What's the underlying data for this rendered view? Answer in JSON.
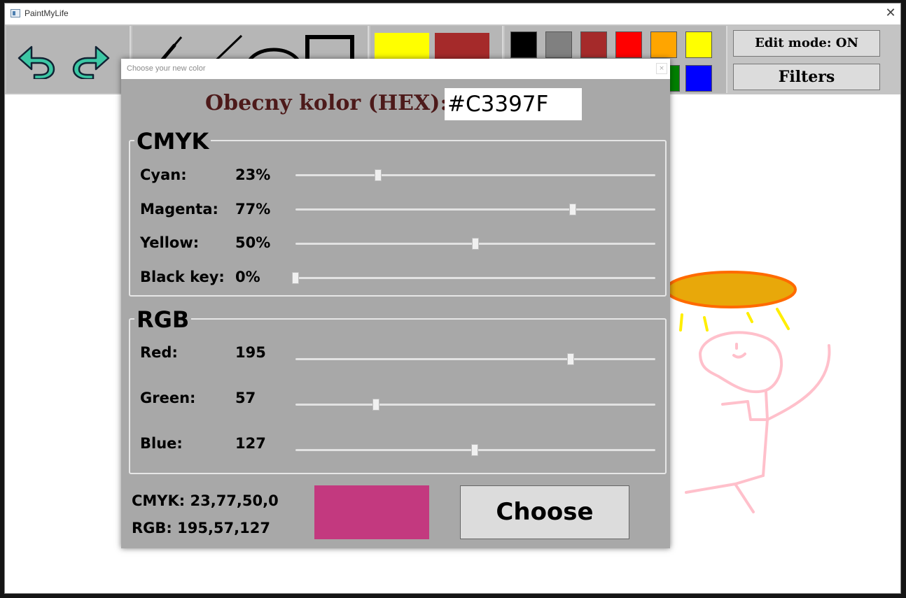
{
  "app": {
    "title": "PaintMyLife",
    "close_glyph": "✕"
  },
  "toolbar": {
    "undo_icon": "undo-arrow",
    "redo_icon": "redo-arrow",
    "primary_color": "#FFFF00",
    "secondary_color": "#A52A2A",
    "palette": [
      {
        "name": "black",
        "hex": "#000000"
      },
      {
        "name": "gray",
        "hex": "#808080"
      },
      {
        "name": "brown",
        "hex": "#A52A2A"
      },
      {
        "name": "red",
        "hex": "#FF0000"
      },
      {
        "name": "orange",
        "hex": "#FFA500"
      },
      {
        "name": "yellow",
        "hex": "#FFFF00"
      },
      {
        "name": "green",
        "hex": "#008000"
      },
      {
        "name": "blue",
        "hex": "#0000FF"
      }
    ],
    "edit_mode_label": "Edit mode: ON",
    "filters_label": "Filters"
  },
  "dialog": {
    "title": "Choose your new color",
    "close_glyph": "×",
    "hex_label": "Obecny kolor (HEX):",
    "hex_value": "#C3397F",
    "cmyk": {
      "title": "CMYK",
      "rows": [
        {
          "label": "Cyan:",
          "value": "23%",
          "level": 0.23
        },
        {
          "label": "Magenta:",
          "value": "77%",
          "level": 0.77
        },
        {
          "label": "Yellow:",
          "value": "50%",
          "level": 0.5
        },
        {
          "label": "Black key:",
          "value": "0%",
          "level": 0.0
        }
      ]
    },
    "rgb": {
      "title": "RGB",
      "rows": [
        {
          "label": "Red:",
          "value": "195",
          "level": 0.765
        },
        {
          "label": "Green:",
          "value": "57",
          "level": 0.224
        },
        {
          "label": "Blue:",
          "value": "127",
          "level": 0.498
        }
      ]
    },
    "summary_cmyk": "CMYK: 23,77,50,0",
    "summary_rgb": "RGB: 195,57,127",
    "preview_color": "#C3397F",
    "choose_label": "Choose"
  },
  "canvas_colors": {
    "halo_fill": "#E8A80A",
    "halo_stroke": "#FF6A00",
    "rays": "#FFEE00",
    "figure": "#FFC0CB"
  }
}
